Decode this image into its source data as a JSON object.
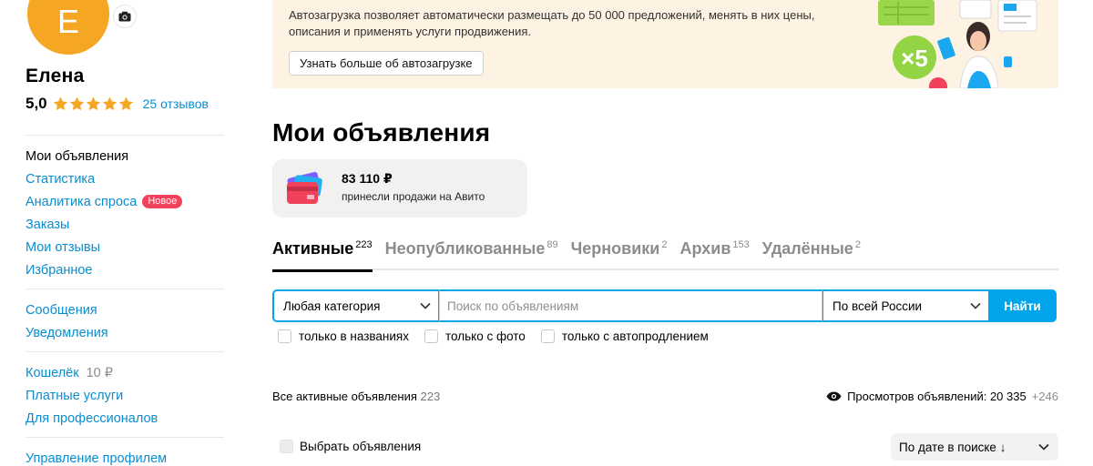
{
  "profile": {
    "avatar_letter": "Е",
    "name": "Елена",
    "rating": "5,0",
    "reviews_link": "25 отзывов"
  },
  "sidebar": {
    "group1": [
      {
        "label": "Мои объявления",
        "active": true
      },
      {
        "label": "Статистика"
      },
      {
        "label": "Аналитика спроса",
        "badge": "Новое"
      },
      {
        "label": "Заказы"
      },
      {
        "label": "Мои отзывы"
      },
      {
        "label": "Избранное"
      }
    ],
    "group2": [
      {
        "label": "Сообщения"
      },
      {
        "label": "Уведомления"
      }
    ],
    "group3": [
      {
        "label": "Кошелёк",
        "amount": "10 ₽"
      },
      {
        "label": "Платные услуги"
      },
      {
        "label": "Для профессионалов"
      }
    ],
    "group4": [
      {
        "label": "Управление профилем"
      }
    ]
  },
  "banner": {
    "text": "Автозагрузка позволяет автоматически размещать до 50 000 предложений, менять в них цены, описания и применять услуги продвижения.",
    "button": "Узнать больше об автозагрузке",
    "multiplier": "×5"
  },
  "main": {
    "title": "Мои объявления",
    "sales": {
      "amount": "83 110 ₽",
      "caption": "принесли продажи на Авито"
    },
    "tabs": [
      {
        "label": "Активные",
        "count": "223",
        "active": true
      },
      {
        "label": "Неопубликованные",
        "count": "89"
      },
      {
        "label": "Черновики",
        "count": "2"
      },
      {
        "label": "Архив",
        "count": "153"
      },
      {
        "label": "Удалённые",
        "count": "2"
      }
    ],
    "search": {
      "category": "Любая категория",
      "placeholder": "Поиск по объявлениям",
      "region": "По всей России",
      "button": "Найти"
    },
    "filters": [
      "только в названиях",
      "только с фото",
      "только с автопродлением"
    ],
    "summary": {
      "label": "Все активные объявления",
      "count": "223",
      "views_label": "Просмотров объявлений: 20 335",
      "views_delta": "+246"
    },
    "select_all": "Выбрать объявления",
    "sort": "По дате в поиске ↓"
  },
  "colors": {
    "accent": "#02a4ea",
    "link": "#0a8dcf",
    "avatar": "#f5a623",
    "badge": "#f0425b",
    "banner_bg": "#fef2e2",
    "star": "#f5a623"
  }
}
